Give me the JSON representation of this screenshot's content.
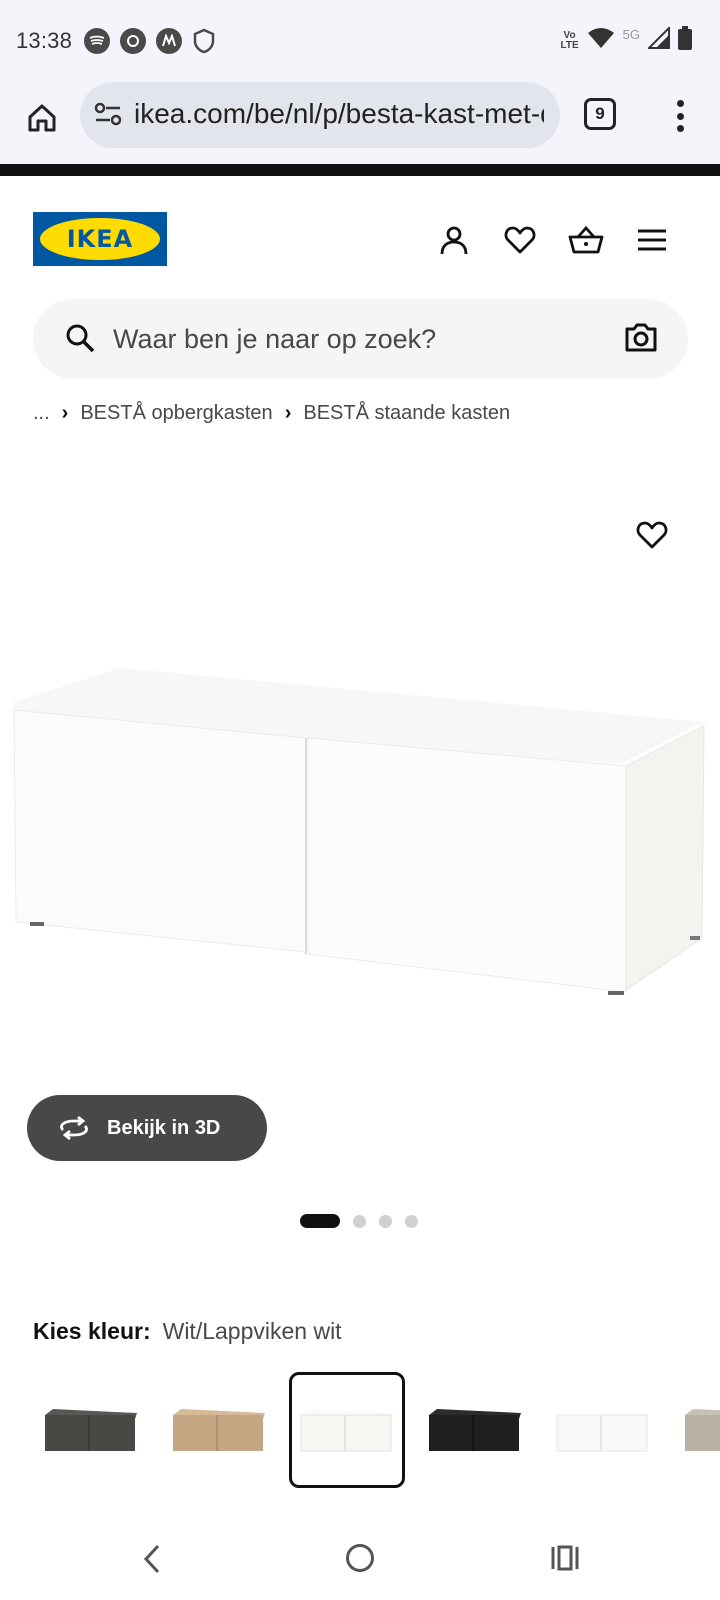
{
  "status_bar": {
    "time": "13:38",
    "left_icons": [
      "spotify-icon",
      "chrome-like-icon",
      "motorola-icon",
      "shield-icon"
    ],
    "network_label_top": "Vo",
    "network_label_bottom": "LTE",
    "network_type": "5G",
    "right_icons": [
      "wifi-icon",
      "signal-icon",
      "battery-icon"
    ]
  },
  "browser": {
    "url": "ikea.com/be/nl/p/besta-kast-met-deuren",
    "tab_count": "9"
  },
  "header": {
    "logo_text": "IKEA",
    "icons": [
      "account-icon",
      "heart-icon",
      "basket-icon",
      "hamburger-menu-icon"
    ]
  },
  "search": {
    "placeholder": "Waar ben je naar op zoek?"
  },
  "breadcrumb": {
    "ellipsis": "...",
    "items": [
      "BESTÅ opbergkasten",
      "BESTÅ staande kasten"
    ]
  },
  "product": {
    "view_3d_label": "Bekijk in 3D",
    "image_count": 4,
    "active_image_index": 0
  },
  "colour": {
    "label": "Kies kleur:",
    "value": "Wit/Lappviken wit",
    "swatches": [
      {
        "name": "dark-grey",
        "color": "#4a4845",
        "selected": false
      },
      {
        "name": "oak",
        "color": "#c6a582",
        "selected": false
      },
      {
        "name": "white",
        "color": "#f6f6f3",
        "selected": true
      },
      {
        "name": "black-brown",
        "color": "#1f1f1f",
        "selected": false
      },
      {
        "name": "white-glossy",
        "color": "#f8f8f8",
        "selected": false
      },
      {
        "name": "beige",
        "color": "#b9b1a3",
        "selected": false
      }
    ]
  },
  "colors": {
    "ikea_blue": "#0058a3",
    "ikea_yellow": "#ffdb00",
    "button_dark": "#484848"
  }
}
